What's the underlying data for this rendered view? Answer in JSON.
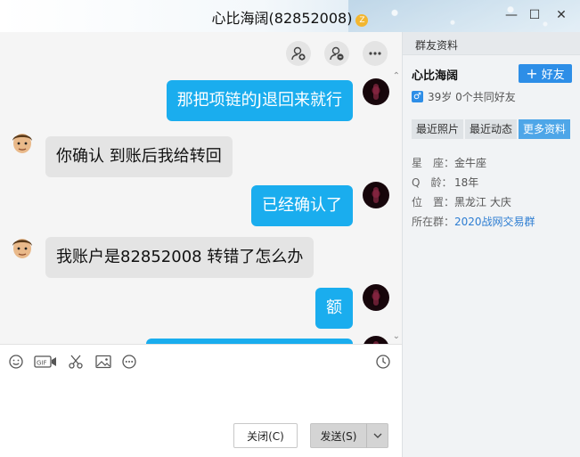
{
  "window": {
    "title": "心比海阔(82852008)",
    "badge": "Z",
    "minimize": "—",
    "maximize": "☐",
    "close": "✕"
  },
  "messages": [
    {
      "side": "me",
      "text": "那把项链的J退回来就行"
    },
    {
      "side": "them",
      "text": "你确认 到账后我给转回"
    },
    {
      "side": "me",
      "text": "已经确认了"
    },
    {
      "side": "them",
      "text": "我账户是82852008  转错了怎么办"
    },
    {
      "side": "me",
      "text": "额"
    }
  ],
  "input": {
    "close_label": "关闭(C)",
    "send_label": "发送(S)"
  },
  "panel": {
    "header": "群友资料",
    "name": "心比海阔",
    "add_friend_label": "好友",
    "gender": "♂",
    "meta": "39岁 0个共同好友",
    "tabs": [
      {
        "label": "最近照片",
        "active": false
      },
      {
        "label": "最近动态",
        "active": false
      },
      {
        "label": "更多资料",
        "active": true
      }
    ],
    "info": [
      {
        "key": "星　座：",
        "value": "金牛座"
      },
      {
        "key": "Q　龄：",
        "value": "18年"
      },
      {
        "key": "位　置：",
        "value": "黑龙江 大庆"
      },
      {
        "key": "所在群：",
        "value": "2020战网交易群"
      }
    ]
  },
  "colors": {
    "my_bubble": "#1aadee",
    "their_bubble": "#e4e4e4",
    "accent": "#2d8ee7"
  }
}
